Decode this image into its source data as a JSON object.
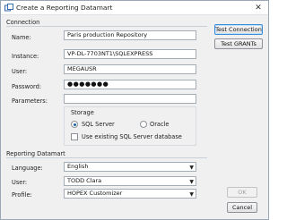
{
  "window": {
    "title": "Create a Reporting Datamart"
  },
  "connection": {
    "legend": "Connection",
    "name_label": "Name:",
    "name_value": "Paris production Repository",
    "instance_label": "Instance:",
    "instance_value": "VP-DL-7703NT1\\SQLEXPRESS",
    "user_label": "User:",
    "user_value": "MEGAUSR",
    "password_label": "Password:",
    "password_value": "●●●●●●●",
    "parameters_label": "Parameters:",
    "parameters_value": "",
    "storage": {
      "legend": "Storage",
      "sql_server_label": "SQL Server",
      "oracle_label": "Oracle",
      "selected": "SQL Server",
      "use_existing_label": "Use existing SQL Server database",
      "use_existing_checked": false
    }
  },
  "actions": {
    "test_connection": "Test Connection",
    "test_grants": "Test GRANTs"
  },
  "datamart": {
    "legend": "Reporting Datamart",
    "language_label": "Language:",
    "language_value": "English",
    "user_label": "User:",
    "user_value": "TODD Clara",
    "profile_label": "Profile:",
    "profile_value": "HOPEX Customizer"
  },
  "footer": {
    "ok": "OK",
    "cancel": "Cancel"
  },
  "icons": {
    "close": "close-icon",
    "app": "app-icon",
    "dropdown": "chevron-down-icon"
  }
}
